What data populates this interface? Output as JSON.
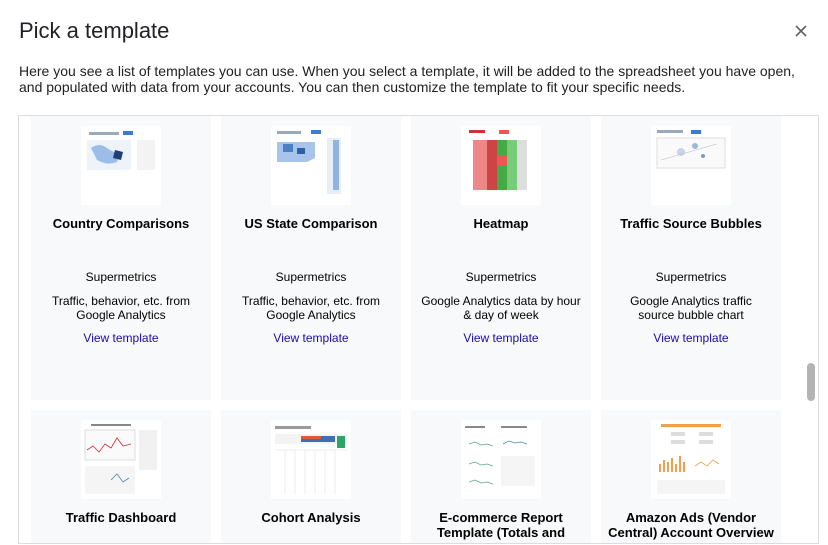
{
  "dialog": {
    "title": "Pick a template",
    "description": "Here you see a list of templates you can use. When you select a template, it will be added to the spreadsheet you have open, and populated with data from your accounts. You can then customize the template to fit your specific needs."
  },
  "cards_row1": [
    {
      "title": "Country Comparisons",
      "author": "Supermetrics",
      "desc": "Traffic, behavior, etc. from Google Analytics",
      "link": "View template"
    },
    {
      "title": "US State Comparison",
      "author": "Supermetrics",
      "desc": "Traffic, behavior, etc. from Google Analytics",
      "link": "View template"
    },
    {
      "title": "Heatmap",
      "author": "Supermetrics",
      "desc": "Google Analytics data by hour & day of week",
      "link": "View template"
    },
    {
      "title": "Traffic Source Bubbles",
      "author": "Supermetrics",
      "desc": "Google Analytics traffic source bubble chart",
      "link": "View template"
    }
  ],
  "cards_row2": [
    {
      "title": "Traffic Dashboard"
    },
    {
      "title": "Cohort Analysis"
    },
    {
      "title": "E-commerce Report Template (Totals and"
    },
    {
      "title": "Amazon Ads (Vendor Central) Account Overview"
    }
  ],
  "colors": {
    "link": "#1a0dab",
    "card_bg": "#f8f9fa",
    "border": "#dadce0"
  }
}
